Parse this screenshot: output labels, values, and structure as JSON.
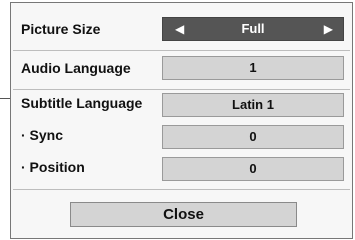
{
  "menu": {
    "picture_size": {
      "label": "Picture Size",
      "value": "Full",
      "left_arrow": "◀",
      "right_arrow": "▶"
    },
    "audio_language": {
      "label": "Audio Language",
      "value": "1"
    },
    "subtitle_language": {
      "label": "Subtitle Language",
      "value": "Latin 1"
    },
    "sync": {
      "label": "· Sync",
      "value": "0"
    },
    "position": {
      "label": "· Position",
      "value": "0"
    },
    "close_label": "Close"
  },
  "colors": {
    "selected_bg": "#555555",
    "box_bg": "#d4d4d4",
    "panel_bg": "#f7f7f7"
  }
}
